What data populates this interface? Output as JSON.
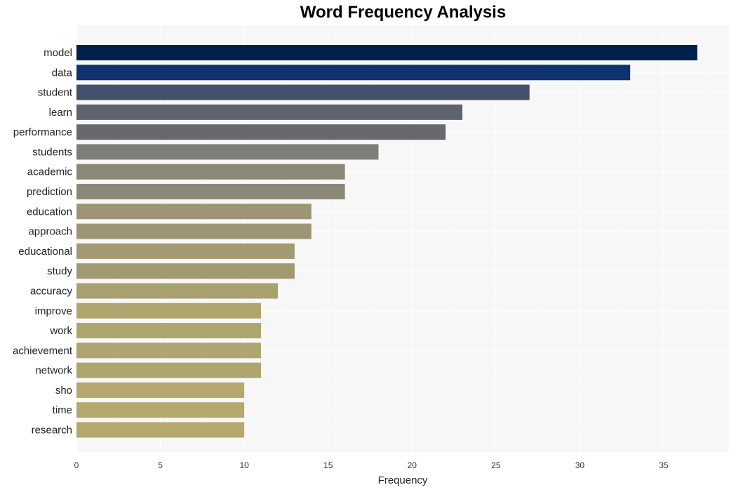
{
  "chart_data": {
    "type": "bar",
    "orientation": "horizontal",
    "title": "Word Frequency Analysis",
    "xlabel": "Frequency",
    "ylabel": "",
    "xlim": [
      0,
      38.8
    ],
    "xticks": [
      0,
      5,
      10,
      15,
      20,
      25,
      30,
      35
    ],
    "grid": true,
    "categories": [
      "model",
      "data",
      "student",
      "learn",
      "performance",
      "students",
      "academic",
      "prediction",
      "education",
      "approach",
      "educational",
      "study",
      "accuracy",
      "improve",
      "work",
      "achievement",
      "network",
      "sho",
      "time",
      "research"
    ],
    "values": [
      37,
      33,
      27,
      23,
      22,
      18,
      16,
      16,
      14,
      14,
      13,
      13,
      12,
      11,
      11,
      11,
      11,
      10,
      10,
      10
    ],
    "colors": [
      "#00204c",
      "#0e336e",
      "#45506b",
      "#5f636f",
      "#67696f",
      "#7e7d79",
      "#8c8878",
      "#8c8878",
      "#9d9575",
      "#9d9575",
      "#a29a73",
      "#a29a73",
      "#a9a070",
      "#aea56f",
      "#aea56f",
      "#aea56f",
      "#aea56f",
      "#b4a86e",
      "#b4a86e",
      "#b4a86e"
    ]
  }
}
